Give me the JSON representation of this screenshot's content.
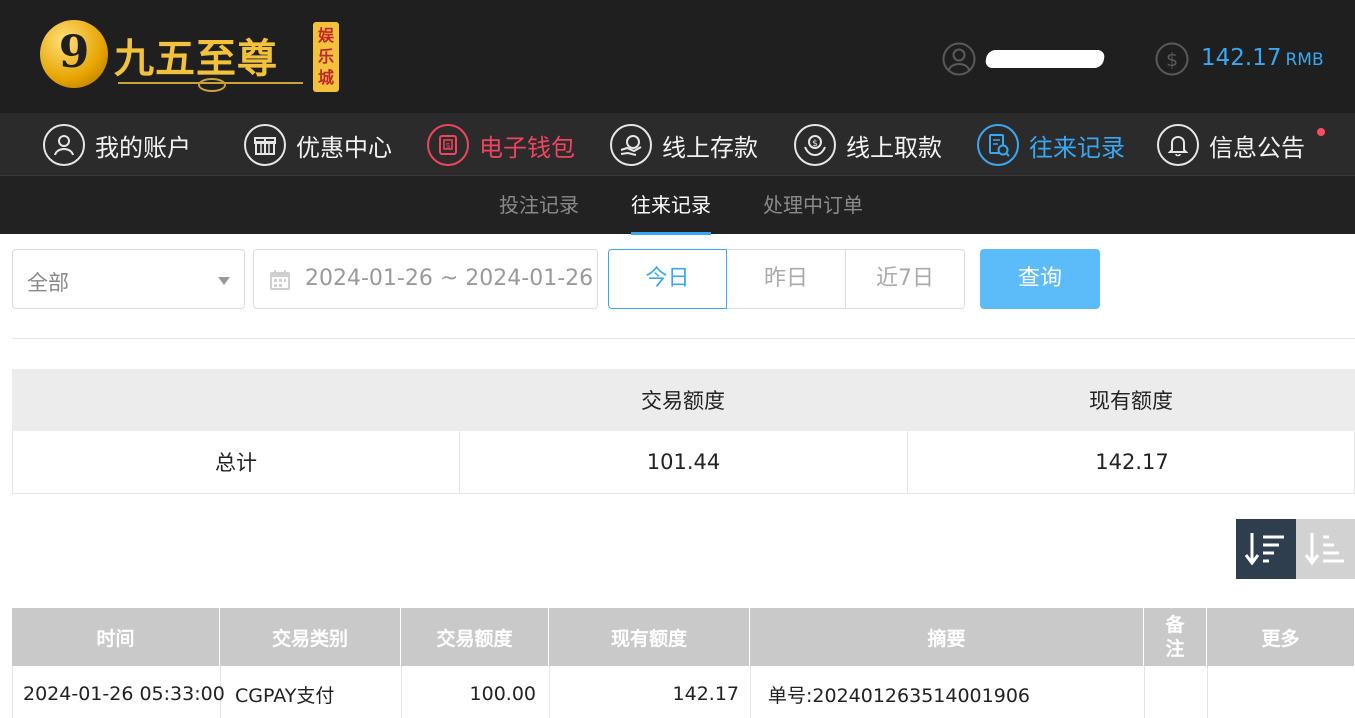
{
  "header": {
    "logo_text": "九五至尊",
    "logo_badge": "娱乐城",
    "logo_mark": "9",
    "balance_amount": "142.17",
    "balance_currency": "RMB"
  },
  "main_nav": [
    {
      "label": "我的账户",
      "icon": "user-icon"
    },
    {
      "label": "优惠中心",
      "icon": "gift-icon"
    },
    {
      "label": "电子钱包",
      "icon": "wallet-icon"
    },
    {
      "label": "线上存款",
      "icon": "deposit-icon"
    },
    {
      "label": "线上取款",
      "icon": "withdraw-icon"
    },
    {
      "label": "往来记录",
      "icon": "records-icon"
    },
    {
      "label": "信息公告",
      "icon": "bell-icon"
    }
  ],
  "sub_nav": [
    {
      "label": "投注记录"
    },
    {
      "label": "往来记录"
    },
    {
      "label": "处理中订单"
    }
  ],
  "filters": {
    "type_select": "全部",
    "date_range": "2024-01-26 ~ 2024-01-26",
    "quick_today": "今日",
    "quick_yesterday": "昨日",
    "quick_7days": "近7日",
    "query_button": "查询"
  },
  "summary": {
    "headers": [
      "",
      "交易额度",
      "现有额度"
    ],
    "row": {
      "label": "总计",
      "transaction_amount": "101.44",
      "current_balance": "142.17"
    }
  },
  "records": {
    "headers": [
      "时间",
      "交易类别",
      "交易额度",
      "现有额度",
      "摘要",
      "备注",
      "更多"
    ],
    "rows": [
      {
        "time": "2024-01-26 05:33:00",
        "type": "CGPAY支付",
        "amount": "100.00",
        "balance": "142.17",
        "summary": "单号:202401263514001906",
        "remark": "",
        "more": ""
      }
    ]
  },
  "colors": {
    "accent": "#3aa7f2",
    "wallet": "#f0445e",
    "header_bg": "#1f1f1f",
    "query_button": "#5bbcf9"
  }
}
